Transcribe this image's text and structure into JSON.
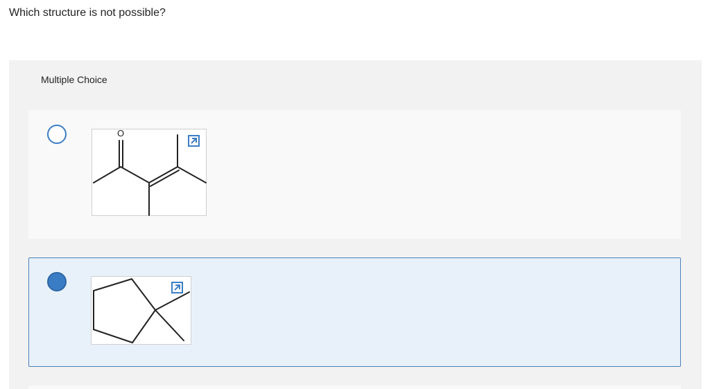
{
  "question": {
    "text": "Which structure is not possible?"
  },
  "multiple_choice": {
    "label": "Multiple Choice",
    "choices": [
      {
        "structure": "ketone with adjacent tetrasubstituted alkene",
        "atom_label": "O",
        "selected": false,
        "expand_icon": "expand-arrow-icon"
      },
      {
        "structure": "cyclopentane with pentavalent carbon",
        "selected": true,
        "expand_icon": "expand-arrow-icon"
      }
    ]
  },
  "colors": {
    "accent": "#3b7dc4",
    "selected_background": "#e8f1fa",
    "panel_background": "#f2f2f2"
  }
}
